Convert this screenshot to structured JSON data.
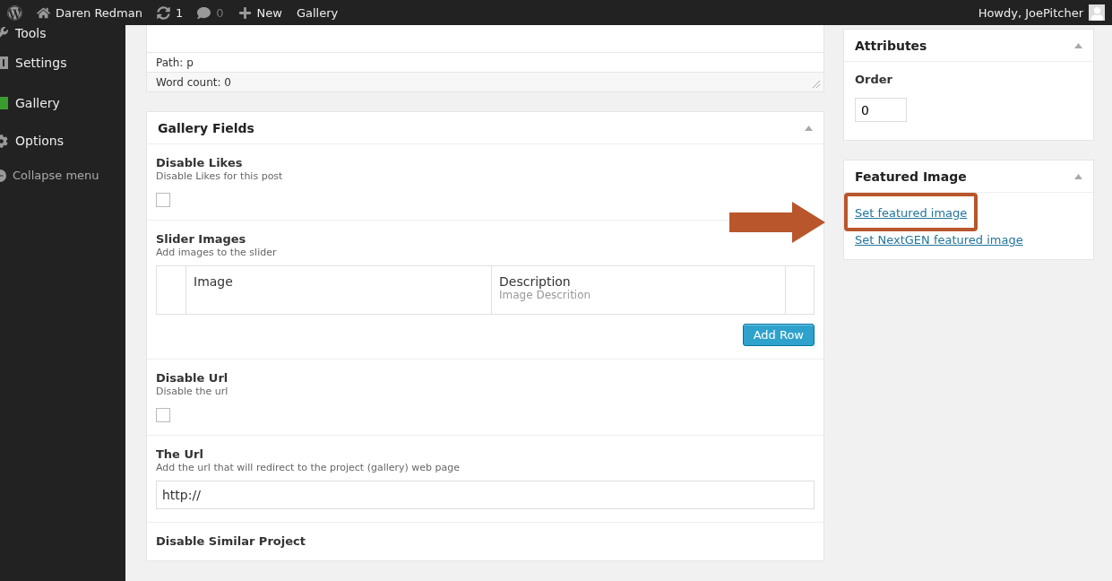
{
  "admin_bar": {
    "items": [
      {
        "kind": "logo"
      },
      {
        "kind": "site",
        "label": "Daren Redman"
      },
      {
        "kind": "updates",
        "label": "1"
      },
      {
        "kind": "comments",
        "label": "0"
      },
      {
        "kind": "new",
        "label": "New"
      },
      {
        "kind": "link",
        "label": "Gallery"
      }
    ],
    "greeting": "Howdy, JoePitcher"
  },
  "menu": {
    "items": [
      {
        "label": "Tools",
        "kind": "wrench"
      },
      {
        "label": "Settings",
        "kind": "settings"
      },
      {
        "label": "Gallery",
        "kind": "square"
      },
      {
        "label": "Options",
        "kind": "gear"
      }
    ],
    "collapse": "Collapse menu"
  },
  "editor": {
    "path": "Path: p",
    "word_count": "Word count: 0"
  },
  "gallery_fields": {
    "title": "Gallery Fields",
    "fields": [
      {
        "kind": "checkbox",
        "label": "Disable Likes",
        "hint": "Disable Likes for this post",
        "checked": false
      },
      {
        "kind": "repeater",
        "label": "Slider Images",
        "hint": "Add images to the slider",
        "columns": [
          {
            "label": "Image"
          },
          {
            "label": "Description",
            "hint": "Image Descrition"
          }
        ],
        "button": "Add Row"
      },
      {
        "kind": "checkbox",
        "label": "Disable Url",
        "hint": "Disable the url",
        "checked": false
      },
      {
        "kind": "text",
        "label": "The Url",
        "hint": "Add the url that will redirect to the project (gallery) web page",
        "value": "http://"
      },
      {
        "kind": "cut",
        "label": "Disable Similar Project"
      }
    ]
  },
  "attributes": {
    "title": "Attributes",
    "order_label": "Order",
    "order_value": "0"
  },
  "featured_image": {
    "title": "Featured Image",
    "links": [
      {
        "label": "Set featured image",
        "highlighted": true
      },
      {
        "label": "Set NextGEN featured image",
        "highlighted": false
      }
    ]
  }
}
